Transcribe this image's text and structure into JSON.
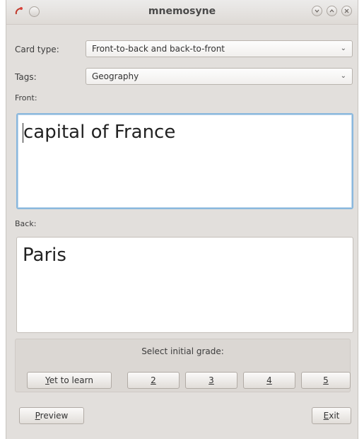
{
  "window": {
    "title": "mnemosyne"
  },
  "form": {
    "card_type_label": "Card type:",
    "card_type_value": "Front-to-back and back-to-front",
    "tags_label": "Tags:",
    "tags_value": "Geography",
    "front_label": "Front:",
    "front_value": "capital of France",
    "back_label": "Back:",
    "back_value": "Paris"
  },
  "grades": {
    "title": "Select initial grade:",
    "buttons": [
      {
        "mnemonic": "Y",
        "rest": "et to learn"
      },
      {
        "mnemonic": "2",
        "rest": ""
      },
      {
        "mnemonic": "3",
        "rest": ""
      },
      {
        "mnemonic": "4",
        "rest": ""
      },
      {
        "mnemonic": "5",
        "rest": ""
      }
    ]
  },
  "footer": {
    "preview": {
      "mnemonic": "P",
      "rest": "review"
    },
    "exit": {
      "mnemonic": "E",
      "rest": "xit"
    }
  },
  "icons": {
    "app": "mnemosyne-app-icon",
    "menu": "window-menu-icon",
    "minimize": "minimize-icon",
    "maximize": "maximize-icon",
    "close": "close-icon"
  }
}
